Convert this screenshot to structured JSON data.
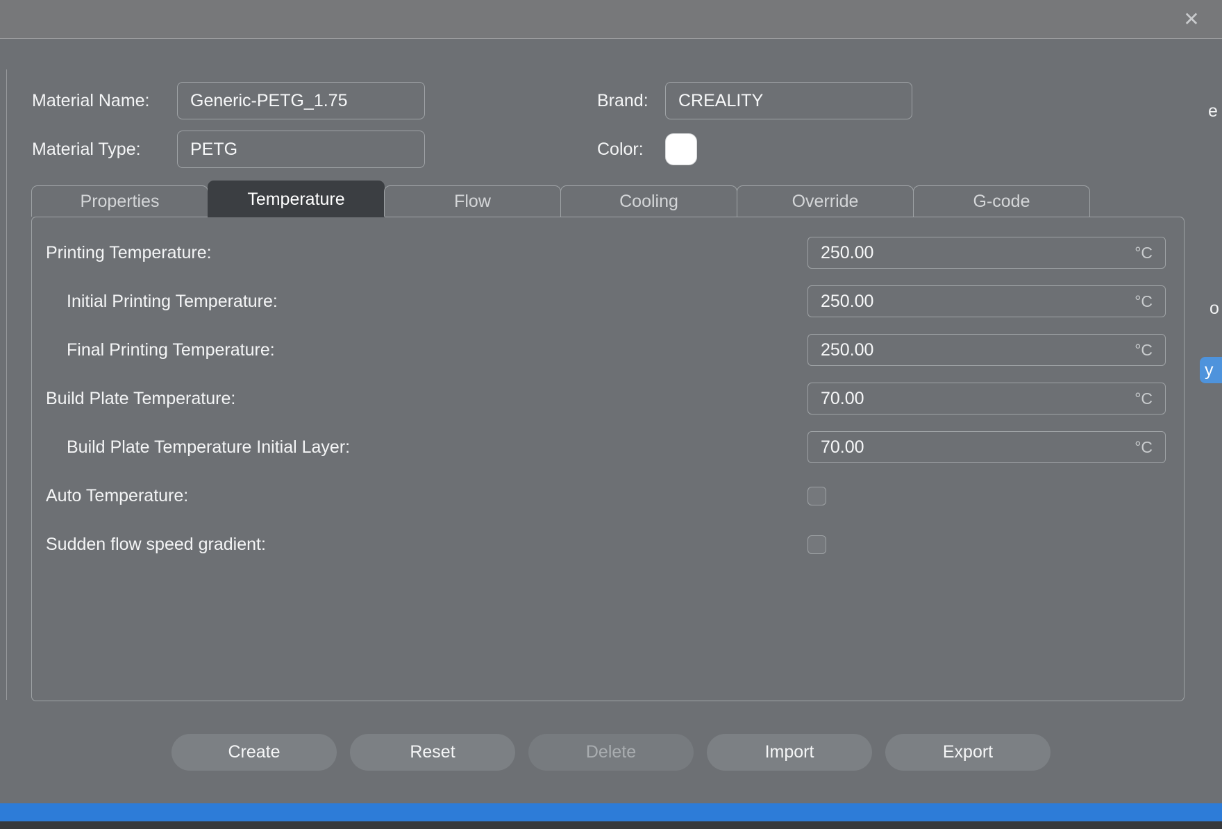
{
  "titlebar": {
    "close_icon": "✕"
  },
  "header": {
    "material_name_label": "Material Name:",
    "material_name_value": "Generic-PETG_1.75",
    "material_type_label": "Material Type:",
    "material_type_value": "PETG",
    "brand_label": "Brand:",
    "brand_value": "CREALITY",
    "color_label": "Color:",
    "color_value": "#ffffff"
  },
  "tabs": [
    {
      "label": "Properties",
      "active": false
    },
    {
      "label": "Temperature",
      "active": true
    },
    {
      "label": "Flow",
      "active": false
    },
    {
      "label": "Cooling",
      "active": false
    },
    {
      "label": "Override",
      "active": false
    },
    {
      "label": "G-code",
      "active": false
    }
  ],
  "panel": {
    "settings": [
      {
        "label": "Printing Temperature:",
        "value": "250.00",
        "unit": "°C",
        "indent": false,
        "type": "number"
      },
      {
        "label": "Initial Printing Temperature:",
        "value": "250.00",
        "unit": "°C",
        "indent": true,
        "type": "number"
      },
      {
        "label": "Final Printing Temperature:",
        "value": "250.00",
        "unit": "°C",
        "indent": true,
        "type": "number"
      },
      {
        "label": "Build Plate Temperature:",
        "value": "70.00",
        "unit": "°C",
        "indent": false,
        "type": "number"
      },
      {
        "label": "Build Plate Temperature Initial Layer:",
        "value": "70.00",
        "unit": "°C",
        "indent": true,
        "type": "number"
      },
      {
        "label": "Auto Temperature:",
        "checked": false,
        "indent": false,
        "type": "checkbox"
      },
      {
        "label": "Sudden flow speed gradient:",
        "checked": false,
        "indent": false,
        "type": "checkbox"
      }
    ]
  },
  "footer": {
    "buttons": [
      {
        "label": "Create",
        "enabled": true
      },
      {
        "label": "Reset",
        "enabled": true
      },
      {
        "label": "Delete",
        "enabled": false
      },
      {
        "label": "Import",
        "enabled": true
      },
      {
        "label": "Export",
        "enabled": true
      }
    ]
  },
  "background": {
    "fragment_top": "e",
    "fragment_middle": "o",
    "fragment_chip": "y"
  },
  "colors": {
    "dialog_bg": "#6d7074",
    "titlebar_bg": "#77787a",
    "border": "#9fa3a6",
    "active_tab_bg": "#3b3e42",
    "button_bg": "#7c8084",
    "accent_blue": "#2d7cd8",
    "chip_blue": "#4e93dc",
    "bottom_bar": "#37393c",
    "color_swatch": "#ffffff"
  }
}
